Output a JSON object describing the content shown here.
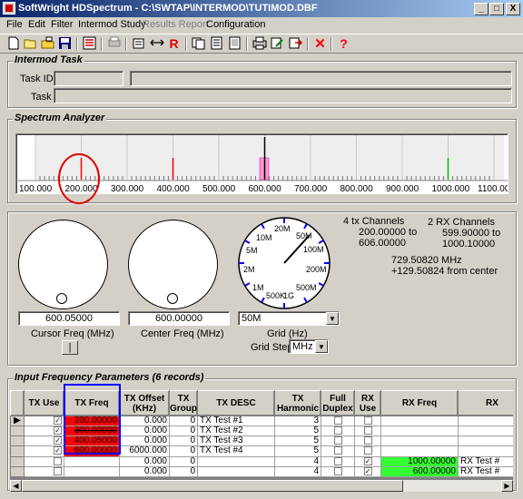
{
  "window": {
    "title": "SoftWright HDSpectrum - C:\\SWTAP\\INTERMOD\\TUTIMOD.DBF",
    "minimize": "_",
    "maximize": "□",
    "close": "X"
  },
  "menu": [
    {
      "label": "File",
      "enabled": true
    },
    {
      "label": "Edit",
      "enabled": true
    },
    {
      "label": "Filter",
      "enabled": true
    },
    {
      "label": "Intermod Study",
      "enabled": true
    },
    {
      "label": "Results Report",
      "enabled": false
    },
    {
      "label": "Configuration",
      "enabled": true
    }
  ],
  "toolbar": {
    "icons": [
      "new-icon",
      "open-icon",
      "folder-icon",
      "save-icon",
      "list-icon",
      "print-preview-icon",
      "calculator-icon",
      "arrows-horizontal-icon",
      "r-icon",
      "copy-icon",
      "document-icon",
      "document2-icon",
      "printer-icon",
      "edit-icon",
      "export-icon",
      "delete-icon",
      "help-icon"
    ],
    "r_label": "R",
    "delete_label": "✕",
    "help_label": "?"
  },
  "intermod_task": {
    "title": "Intermod Task",
    "task_id_label": "Task ID:",
    "task_label": "Task",
    "task_id_value": "",
    "task_id_desc_value": "",
    "task_value": ""
  },
  "spectrum": {
    "title": "Spectrum Analyzer",
    "axis_labels": [
      "100.000",
      "200.000",
      "300.000",
      "400.000",
      "500.000",
      "600.000",
      "700.000",
      "800.000",
      "900.000",
      "1000.000",
      "1100.000"
    ],
    "axis_min": 100,
    "axis_max": 1100,
    "markers": [
      {
        "freq": 200.0,
        "color": "#ff0000"
      },
      {
        "freq": 400.05,
        "color": "#ff0000"
      },
      {
        "freq": 600.0,
        "color": "#000000"
      },
      {
        "freq": 1000.0,
        "color": "#00c000"
      }
    ]
  },
  "controls": {
    "cursor_freq_value": "600.05000",
    "cursor_freq_label": "Cursor Freq (MHz)",
    "center_freq_value": "600.00000",
    "center_freq_label": "Center Freq (MHz)",
    "cursor_button_label": "|",
    "grid_value": "50M",
    "grid_label": "Grid (Hz)",
    "grid_step_label": "Grid Step",
    "grid_step_value": "MHz",
    "dial_labels": [
      "10M",
      "20M",
      "50M",
      "100M",
      "200M",
      "500M",
      "500K",
      "1G",
      "1M",
      "2M",
      "5M"
    ],
    "tx_channels_label": "4 tx Channels",
    "tx_range_from": "200.00000 to",
    "tx_range_to": "606.00000",
    "rx_channels_label": "2 RX Channels",
    "rx_range_from": "599.90000 to",
    "rx_range_to": "1000.10000",
    "cursor_readout": "729.50820 MHz",
    "cursor_offset": "+129.50824 from center"
  },
  "table": {
    "title": "Input Frequency Parameters (6 records)",
    "columns": [
      "TX Use",
      "TX Freq",
      "TX Offset (KHz)",
      "TX Group",
      "TX DESC",
      "TX Harmonic",
      "Full Duplex",
      "RX Use",
      "RX Freq",
      "RX"
    ],
    "rows": [
      {
        "tx_use": true,
        "tx_freq": "200.00000",
        "tx_freq_color": "red",
        "tx_offset": "0.000",
        "tx_group": "0",
        "tx_desc": "TX Test #1",
        "tx_harmonic": "3",
        "full_duplex": false,
        "rx_use": false,
        "rx_freq": "",
        "rx_desc": "",
        "current": true
      },
      {
        "tx_use": true,
        "tx_freq": "300.00000",
        "tx_freq_color": "red-strike",
        "tx_offset": "0.000",
        "tx_group": "0",
        "tx_desc": "TX Test #2",
        "tx_harmonic": "5",
        "full_duplex": false,
        "rx_use": false,
        "rx_freq": "",
        "rx_desc": "",
        "current": false
      },
      {
        "tx_use": true,
        "tx_freq": "400.05000",
        "tx_freq_color": "red",
        "tx_offset": "0.000",
        "tx_group": "0",
        "tx_desc": "TX Test #3",
        "tx_harmonic": "5",
        "full_duplex": false,
        "rx_use": false,
        "rx_freq": "",
        "rx_desc": "",
        "current": false
      },
      {
        "tx_use": true,
        "tx_freq": "600.00000",
        "tx_freq_color": "red",
        "tx_offset": "6000.000",
        "tx_group": "0",
        "tx_desc": "TX Test #4",
        "tx_harmonic": "5",
        "full_duplex": false,
        "rx_use": false,
        "rx_freq": "",
        "rx_desc": "",
        "current": false
      },
      {
        "tx_use": false,
        "tx_freq": "",
        "tx_freq_color": "",
        "tx_offset": "0.000",
        "tx_group": "0",
        "tx_desc": "",
        "tx_harmonic": "4",
        "full_duplex": false,
        "rx_use": true,
        "rx_freq": "1000.00000",
        "rx_desc": "RX Test #",
        "current": false
      },
      {
        "tx_use": false,
        "tx_freq": "",
        "tx_freq_color": "",
        "tx_offset": "0.000",
        "tx_group": "0",
        "tx_desc": "",
        "tx_harmonic": "4",
        "full_duplex": false,
        "rx_use": true,
        "rx_freq": "600.00000",
        "rx_desc": "RX Test #",
        "current": false
      }
    ]
  }
}
